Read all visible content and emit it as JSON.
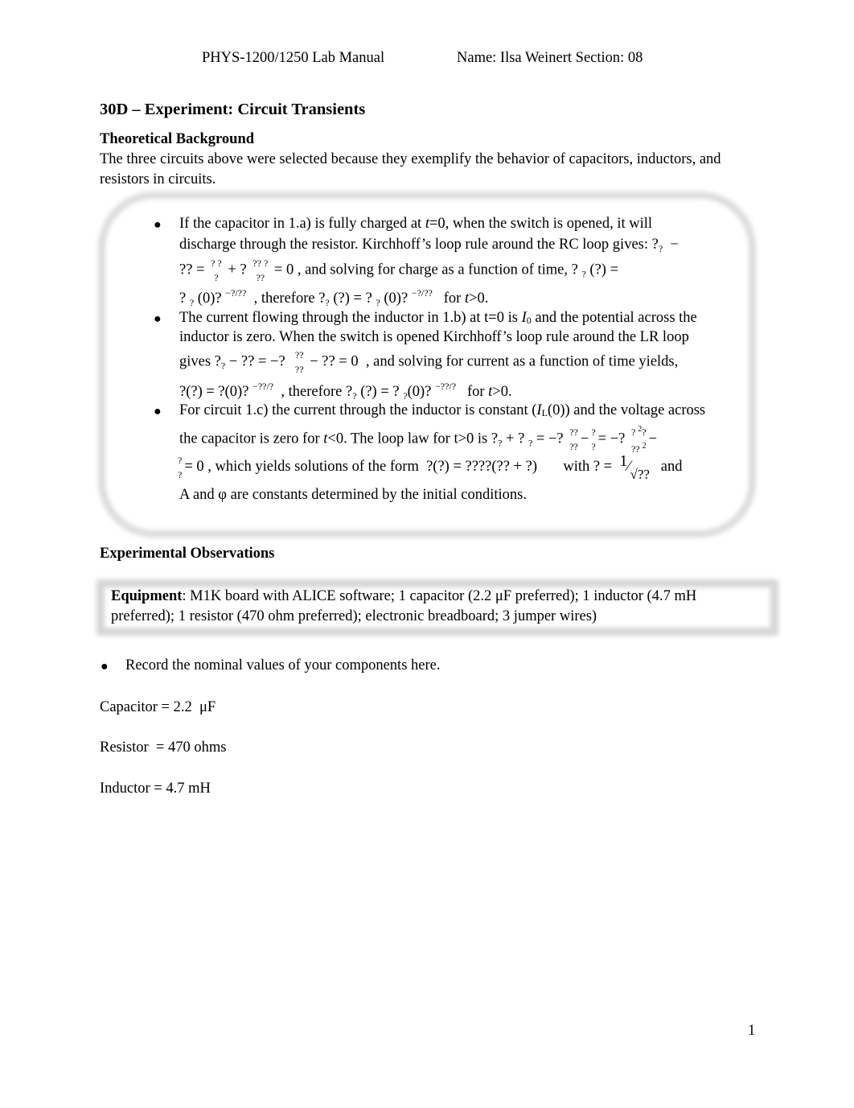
{
  "header": {
    "manual": "PHYS-1200/1250 Lab Manual",
    "name_section": "Name: Ilsa Weinert  Section: 08"
  },
  "title": "30D – Experiment: Circuit Transients",
  "theory": {
    "heading": "Theoretical Background",
    "intro_line1": "The three circuits above were selected because they exemplify the behavior of capacitors, inductors, and",
    "intro_line2": "resistors in circuits.",
    "bullets": [
      {
        "lines": [
          "If the capacitor in 1.a) is fully charged at t=0, when the switch is opened, it will",
          "discharge through the resistor. Kirchhoff’s loop rule around the RC loop gives: ?? −",
          "?? = ?? / ? + ? ?? ? / ?? = 0 , and solving for charge as a function of time, ? ? (?) =",
          "? ? (0)? −?/??  , therefore ?? (?) = ? ? (0)? −?/??   for t>0."
        ]
      },
      {
        "lines": [
          "The current flowing through the inductor in 1.b) at t=0 is I0 and the potential across the",
          "inductor is zero. When the switch is opened Kirchhoff’s loop rule around the LR loop",
          "gives ?? − ?? = −? ??/?? − ?? = 0  , and solving for current as a function of time yields,",
          "?(?) = ?(0)? −??/?  , therefore ?? (?) = ? ?(0)? −??/?   for t>0."
        ]
      },
      {
        "lines": [
          "For circuit 1.c) the current through the inductor is constant (IL(0)) and the voltage across",
          "the capacitor is zero for t<0. The loop law for t>0 is ?? + ? ? = −? ??/?? − ?/? = −? ?²?/??² −",
          "?/? = 0 , which yields solutions of the form  ?(?) = ????(?? + ?)      with ? = 1/√??  and",
          "A and φ are constants determined by the initial conditions."
        ]
      }
    ]
  },
  "observations": {
    "heading": "Experimental Observations",
    "equipment_label": "Equipment",
    "equipment_line1": ": M1K board with ALICE software; 1 capacitor (2.2 μF preferred); 1 inductor (4.7 mH",
    "equipment_line2": "preferred); 1 resistor (470 ohm preferred); electronic breadboard; 3 jumper wires)",
    "record_bullet": "Record the nominal values of your components here.",
    "values": [
      {
        "label": "Capacitor = 2.2  μF"
      },
      {
        "label": "Resistor  = 470 ohms"
      },
      {
        "label": "Inductor = 4.7 mH"
      }
    ]
  },
  "page_number": "1"
}
